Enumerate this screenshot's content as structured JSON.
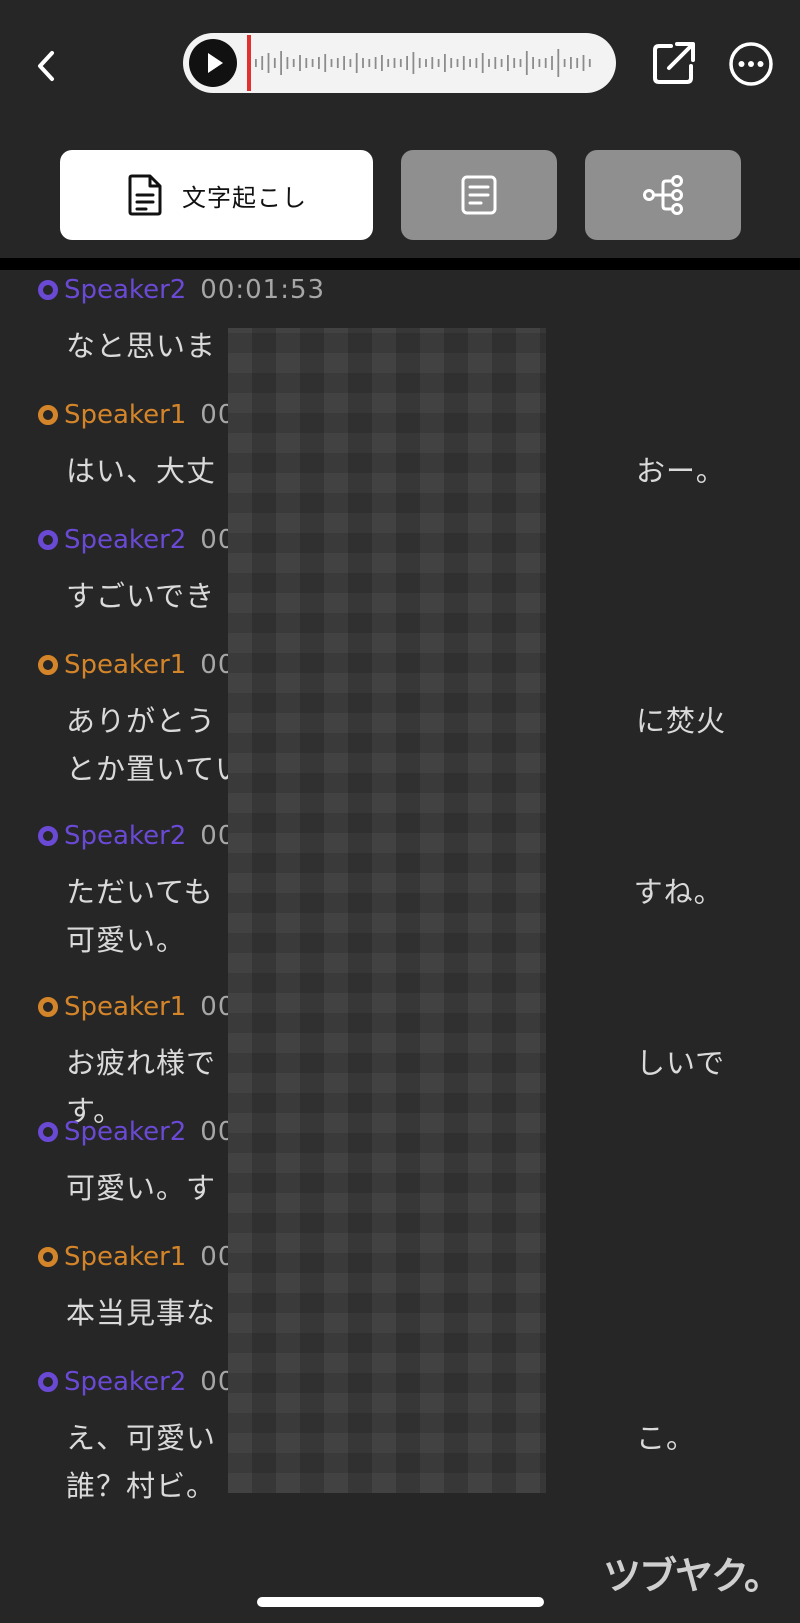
{
  "header": {
    "back_icon": "chevron-left-icon",
    "play_icon": "play-icon",
    "share_icon": "share-icon",
    "more_icon": "more-horizontal-icon"
  },
  "tabs": [
    {
      "label": "文字起こし",
      "icon": "document-icon",
      "active": true
    },
    {
      "label": "",
      "icon": "summary-icon",
      "active": false
    },
    {
      "label": "",
      "icon": "mind-map-icon",
      "active": false
    }
  ],
  "colors": {
    "speaker1": "#d4852a",
    "speaker2": "#6a49d4",
    "playhead": "#e0332f"
  },
  "transcript": [
    {
      "speaker": "Speaker2",
      "time": "00:01:53",
      "text": "なと思いま"
    },
    {
      "speaker": "Speaker1",
      "time": "00",
      "text": "はい、大丈　　　　　　　　　　　　　　おー。"
    },
    {
      "speaker": "Speaker2",
      "time": "00",
      "text": "すごいでき"
    },
    {
      "speaker": "Speaker1",
      "time": "00",
      "text": "ありがとう　　　　　　　　　　　　　　に焚火とか置いてい。"
    },
    {
      "speaker": "Speaker2",
      "time": "00",
      "text": "ただいても　　　　　　　　　　　　　　すね。可愛い。"
    },
    {
      "speaker": "Speaker1",
      "time": "00",
      "text": "お疲れ様で　　　　　　　　　　　　　　しいです。"
    },
    {
      "speaker": "Speaker2",
      "time": "00",
      "text": "可愛い。す"
    },
    {
      "speaker": "Speaker1",
      "time": "00",
      "text": "本当見事な"
    },
    {
      "speaker": "Speaker2",
      "time": "00",
      "text": "え、可愛い　　　　　　　　　　　　　　こ。誰？村ビ。"
    }
  ],
  "watermark": "ツブヤク。"
}
